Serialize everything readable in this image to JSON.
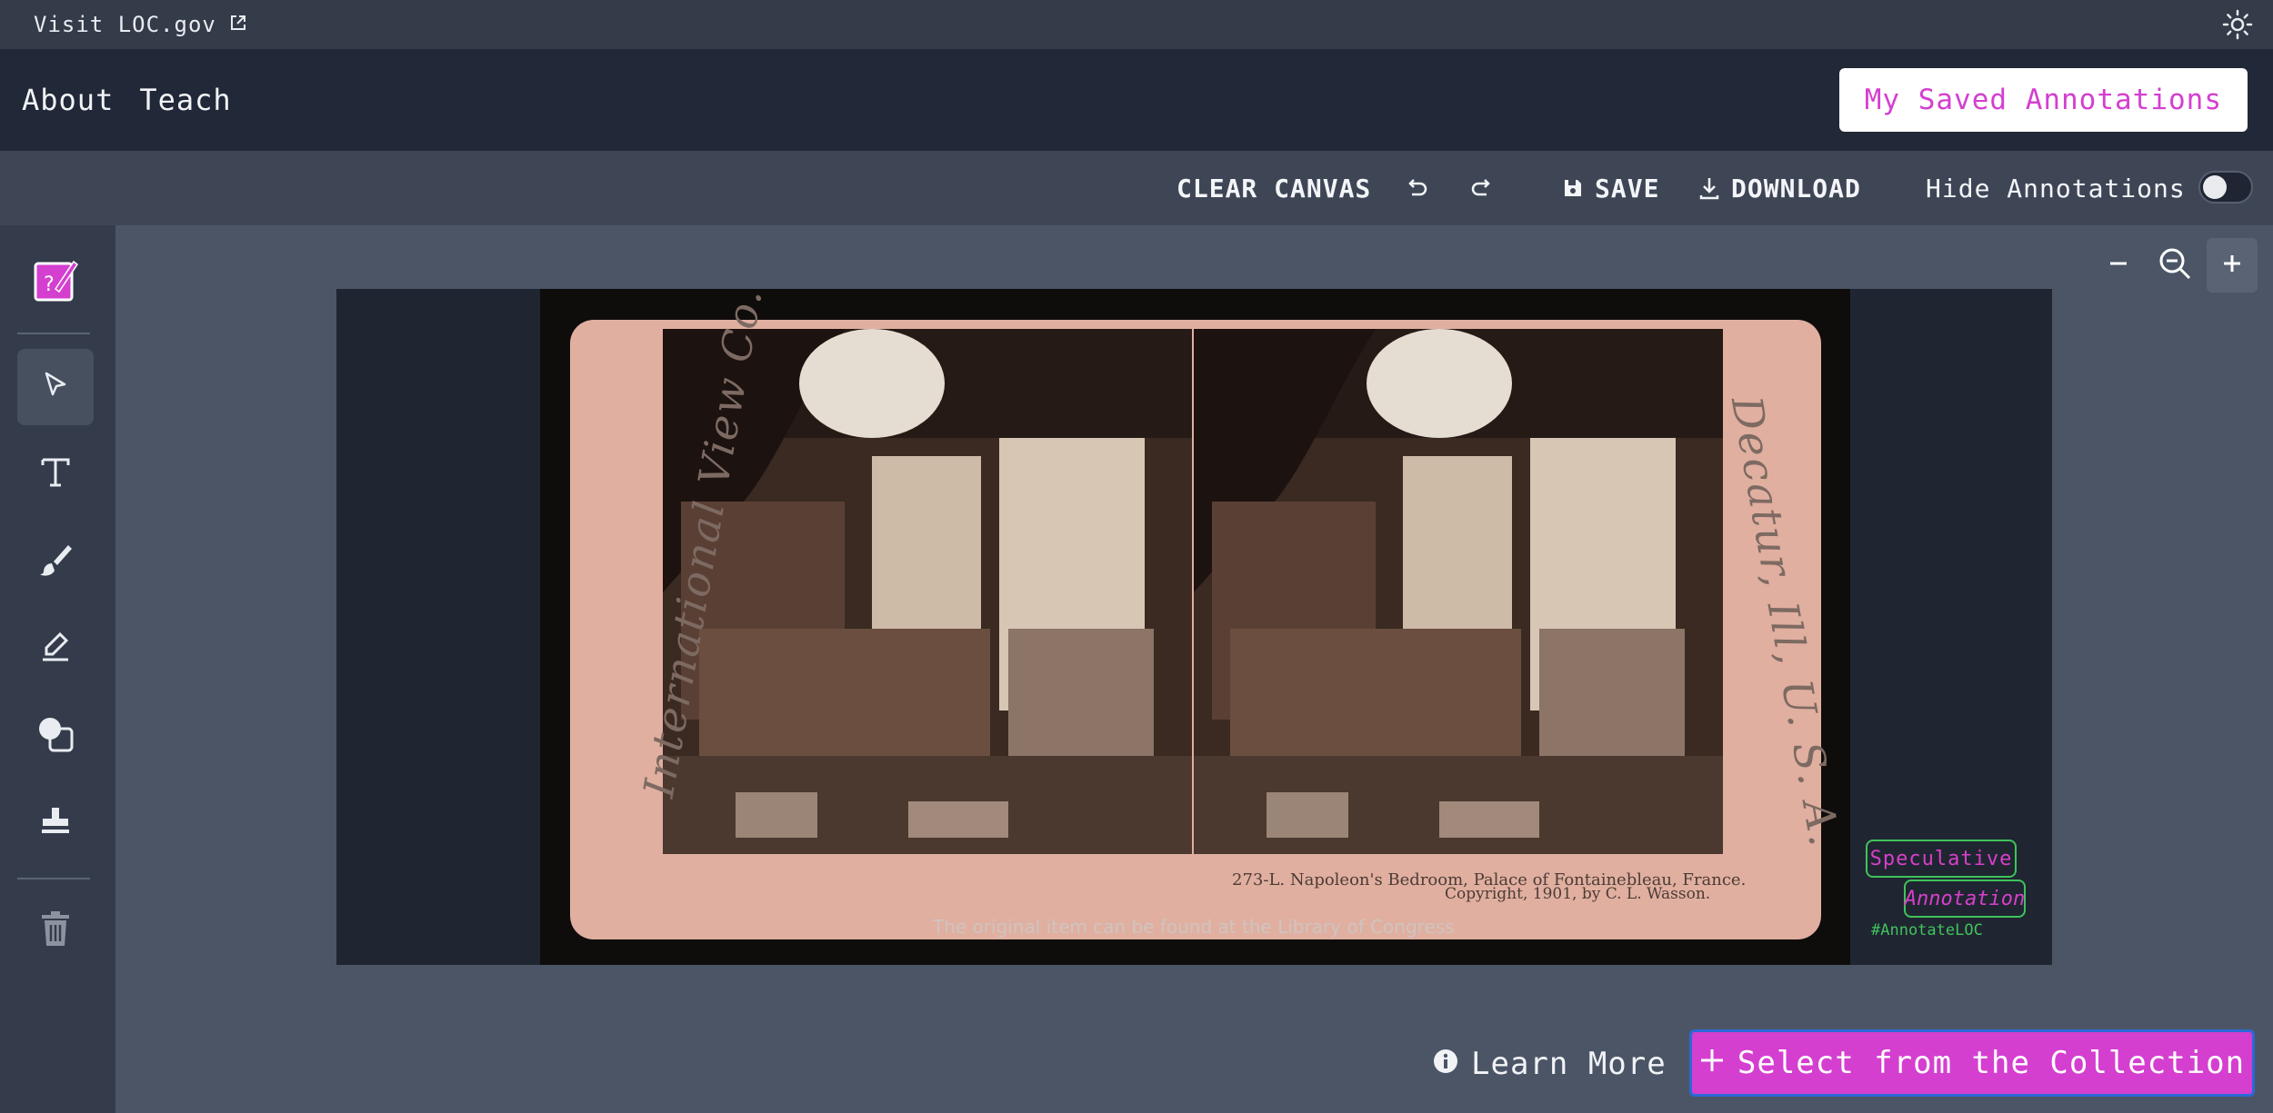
{
  "topbar": {
    "visit_label": "Visit LOC.gov"
  },
  "nav": {
    "about": "About",
    "teach": "Teach",
    "saved_button": "My Saved Annotations"
  },
  "toolbar": {
    "clear_canvas": "CLEAR CANVAS",
    "save": "SAVE",
    "download": "DOWNLOAD",
    "hide_annotations": "Hide Annotations",
    "hide_annotations_on": false
  },
  "sidebar": {
    "tools": [
      "select-tool",
      "text-tool",
      "brush-tool",
      "highlighter-tool",
      "shapes-tool",
      "stamp-tool",
      "trash-tool"
    ],
    "active_tool": "select-tool"
  },
  "zoom": {
    "out": "−",
    "in": "+"
  },
  "image": {
    "left_vertical_text": "International View Co.",
    "right_vertical_text": "Decatur, Ill, U. S. A.",
    "caption_line1": "273-L.  Napoleon's Bedroom, Palace of Fontainebleau, France.",
    "caption_line2": "Copyright, 1901, by C. L. Wasson.",
    "credit": "The original item can be found at the Library of Congress"
  },
  "badge": {
    "line1": "Speculative",
    "line2": "Annotation",
    "hashtag": "#AnnotateLOC"
  },
  "footer": {
    "learn_more": "Learn More",
    "select_collection": "Select from the Collection"
  },
  "colors": {
    "accent": "#d43fd0",
    "green": "#41c25b",
    "nav_bg": "#212837",
    "canvas_bg": "#4b5566"
  }
}
